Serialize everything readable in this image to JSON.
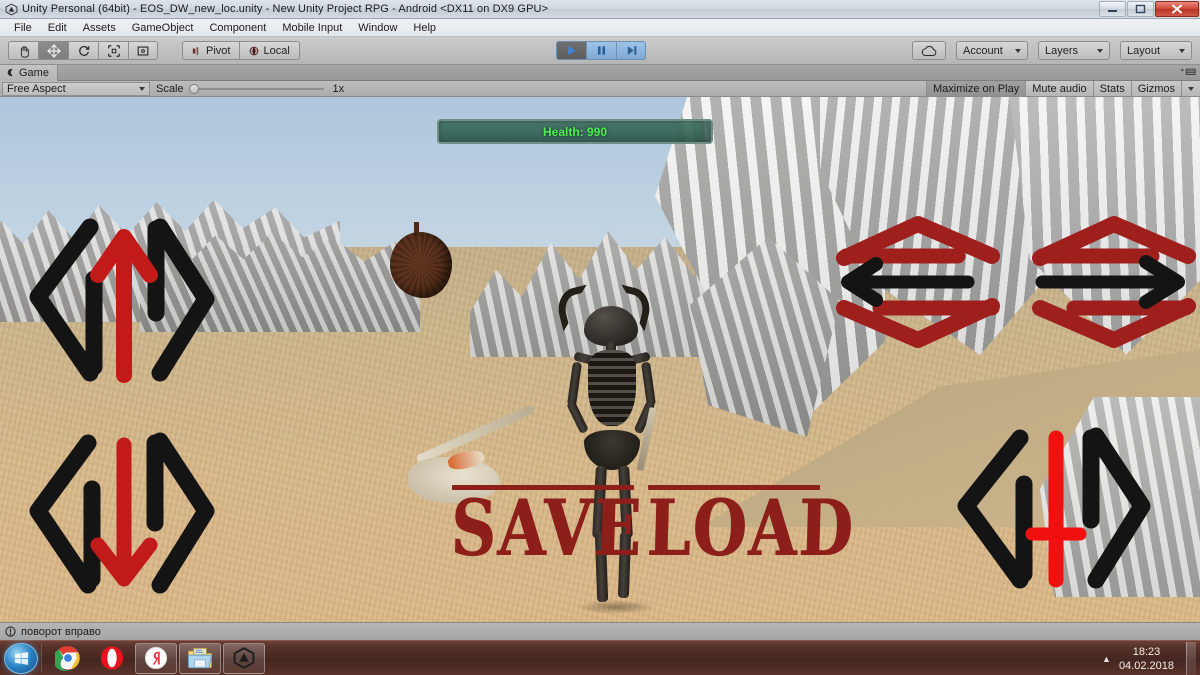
{
  "window": {
    "title": "Unity Personal (64bit) - EOS_DW_new_loc.unity - New Unity Project RPG - Android <DX11 on DX9 GPU>",
    "app_icon": "unity-logo-icon",
    "minimize_label": "—",
    "maximize_label": "❐",
    "close_label": "✕"
  },
  "menu": {
    "items": [
      {
        "label": "File"
      },
      {
        "label": "Edit"
      },
      {
        "label": "Assets"
      },
      {
        "label": "GameObject"
      },
      {
        "label": "Component"
      },
      {
        "label": "Mobile Input"
      },
      {
        "label": "Window"
      },
      {
        "label": "Help"
      }
    ]
  },
  "toolbar": {
    "transform_tools": [
      {
        "name": "hand-tool",
        "icon": "hand-icon",
        "active": false
      },
      {
        "name": "move-tool",
        "icon": "move-arrows-icon",
        "active": true
      },
      {
        "name": "rotate-tool",
        "icon": "rotate-icon",
        "active": false
      },
      {
        "name": "scale-tool",
        "icon": "scale-icon",
        "active": false
      },
      {
        "name": "rect-tool",
        "icon": "rect-transform-icon",
        "active": false
      }
    ],
    "pivot_label": "Pivot",
    "local_label": "Local",
    "play_label": "▶",
    "pause_label": "❙❙",
    "step_label": "▶|",
    "cloud_icon": "cloud-icon",
    "account_label": "Account",
    "layers_label": "Layers",
    "layout_label": "Layout"
  },
  "game_tab": {
    "tab_label": "Game",
    "tab_icon": "game-view-icon",
    "menu_icon": "panel-menu-icon"
  },
  "game_bar": {
    "aspect_label": "Free Aspect",
    "scale_label": "Scale",
    "scale_value": "1x",
    "maximize_label": "Maximize on Play",
    "mute_label": "Mute audio",
    "stats_label": "Stats",
    "gizmos_label": "Gizmos"
  },
  "game": {
    "health_label": "Health: 990",
    "health_percent": 99,
    "health_text_color": "#4cf04c",
    "save_label": "SAVE",
    "load_label": "LOAD",
    "rune_red": "#8d1f1a",
    "controls": [
      {
        "name": "move-forward-control",
        "arrow": "up",
        "arrow_color": "#c11a18",
        "bracket_color": "#141414"
      },
      {
        "name": "move-backward-control",
        "arrow": "down",
        "arrow_color": "#c11a18",
        "bracket_color": "#141414"
      },
      {
        "name": "turn-left-control",
        "arrow": "left",
        "arrow_color": "#141414",
        "bracket_color": "#9e1f1c"
      },
      {
        "name": "turn-right-control",
        "arrow": "right",
        "arrow_color": "#141414",
        "bracket_color": "#9e1f1c"
      },
      {
        "name": "attack-control",
        "arrow": "sword",
        "arrow_color": "#f01010",
        "bracket_color": "#141414"
      }
    ],
    "scene": {
      "sky_color": "#bed2e2",
      "sand_color": "#d8b98a",
      "rock_color": "#cfcfcf",
      "bush_color": "#58301c",
      "character": "skeleton-warrior-with-horned-helmet"
    }
  },
  "status_bar": {
    "icon": "warning-icon",
    "message": "поворот вправо"
  },
  "taskbar": {
    "start_label": "Start",
    "apps": [
      {
        "name": "taskbar-chrome",
        "label": "Google Chrome",
        "pinned": false
      },
      {
        "name": "taskbar-opera",
        "label": "Opera",
        "pinned": false
      },
      {
        "name": "taskbar-yandex",
        "label": "Yandex Browser",
        "pinned": true
      },
      {
        "name": "taskbar-explorer",
        "label": "File Explorer",
        "pinned": true
      },
      {
        "name": "taskbar-unity",
        "label": "Unity",
        "pinned": true
      }
    ],
    "tray_caret": "▲",
    "time": "18:23",
    "date": "04.02.2018"
  }
}
